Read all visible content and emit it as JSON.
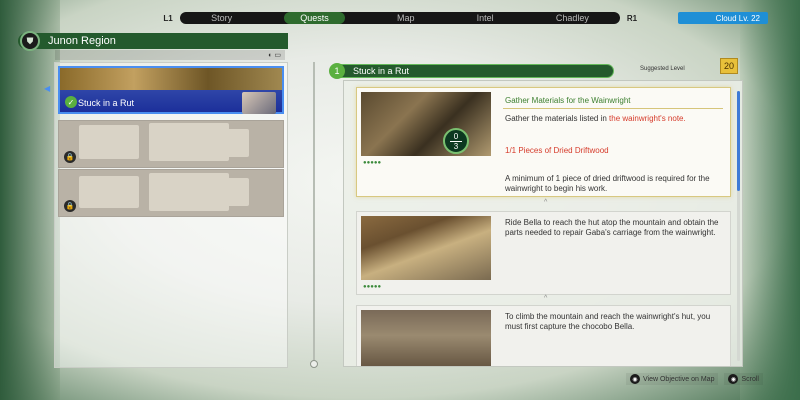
{
  "nav": {
    "left_bumper": "L1",
    "right_bumper": "R1",
    "tabs": [
      {
        "label": "Story",
        "active": false
      },
      {
        "label": "Quests",
        "active": true
      },
      {
        "label": "Map",
        "active": false
      },
      {
        "label": "Intel",
        "active": false
      },
      {
        "label": "Chadley",
        "active": false
      }
    ],
    "level_badge": "Cloud Lv. 22"
  },
  "region": {
    "icon": "region-crest-icon",
    "title": "Junon Region"
  },
  "quests": [
    {
      "name": "Stuck in a Rut",
      "active": true,
      "status_icon": "check-icon"
    },
    {
      "name": "",
      "active": false,
      "status_icon": "lock-icon"
    },
    {
      "name": "",
      "active": false,
      "status_icon": "lock-icon"
    }
  ],
  "detail": {
    "number": "1",
    "title": "Stuck in a Rut",
    "suggested_label": "Suggested Level",
    "suggested_level": "20",
    "steps": [
      {
        "heading": "Gather Materials for the Wainwright",
        "text_pre": "Gather the materials listed in ",
        "text_link": "the wainwright's note.",
        "item": "1/1 Pieces of Dried Driftwood",
        "counter_top": "0",
        "counter_bottom": "3",
        "note": "A minimum of 1 piece of dried driftwood is required for the wainwright to begin his work.",
        "stars": "●●●●●"
      },
      {
        "text": "Ride Bella to reach the hut atop the mountain and obtain the parts needed to repair Gaba's carriage from the wainwright.",
        "stars": "●●●●●"
      },
      {
        "text": "To climb the mountain and reach the wainwright's hut, you must first capture the chocobo Bella."
      }
    ]
  },
  "prompts": {
    "view_objective": "View Objective on Map",
    "scroll": "Scroll"
  }
}
